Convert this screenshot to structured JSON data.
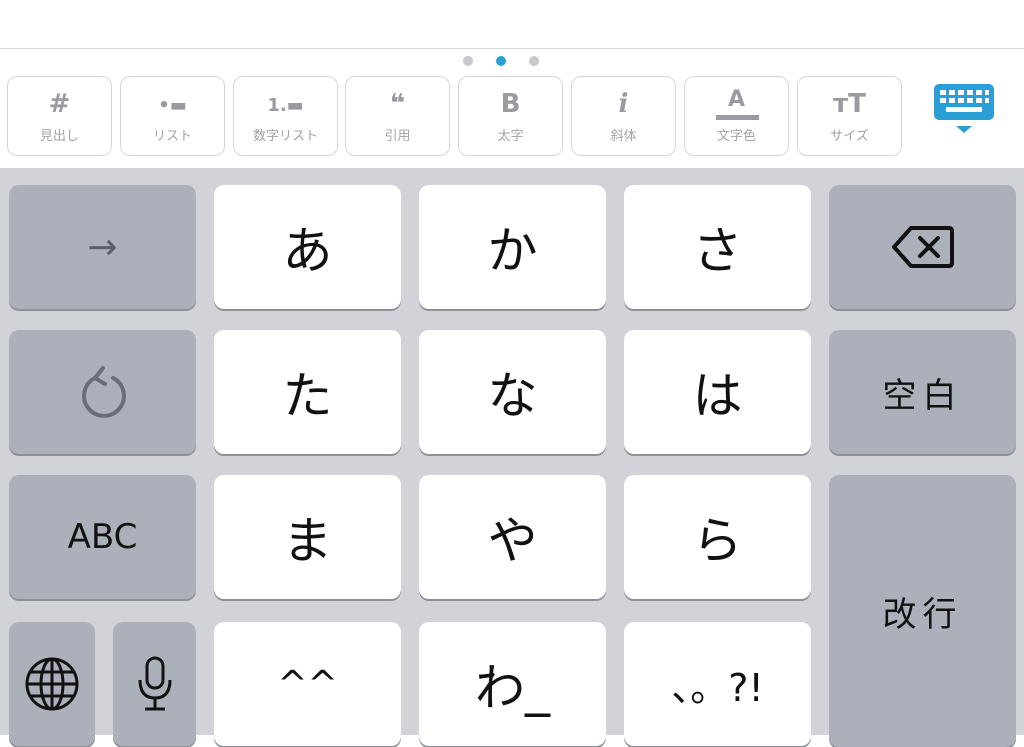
{
  "page_dots": {
    "count": 3,
    "active_index": 1
  },
  "toolbar": {
    "items": [
      {
        "glyph": "#",
        "label": "見出し",
        "icon": "heading-icon"
      },
      {
        "glyph": "•▬",
        "label": "リスト",
        "icon": "bullet-list-icon"
      },
      {
        "glyph": "1.▬",
        "label": "数字リスト",
        "icon": "numbered-list-icon"
      },
      {
        "glyph": "❝",
        "label": "引用",
        "icon": "quote-icon"
      },
      {
        "glyph": "B",
        "label": "太字",
        "icon": "bold-icon"
      },
      {
        "glyph": "i",
        "label": "斜体",
        "icon": "italic-icon"
      },
      {
        "glyph": "A",
        "label": "文字色",
        "icon": "text-color-icon"
      },
      {
        "glyph": "тT",
        "label": "サイズ",
        "icon": "text-size-icon"
      }
    ],
    "keyboard_toggle_icon": "keyboard-hide-icon",
    "accent_color": "#2a9fd6"
  },
  "keyboard": {
    "row1": {
      "left": "→",
      "k1": "あ",
      "k2": "か",
      "k3": "さ",
      "right_icon": "backspace-icon"
    },
    "row2": {
      "left_icon": "undo-icon",
      "k1": "た",
      "k2": "な",
      "k3": "は",
      "right": "空白"
    },
    "row3": {
      "left": "ABC",
      "k1": "ま",
      "k2": "や",
      "k3": "ら",
      "right": "改行"
    },
    "row4": {
      "globe_icon": "globe-icon",
      "mic_icon": "microphone-icon",
      "k1": "^^",
      "k2": "わ_",
      "k3": "、。?!"
    }
  }
}
